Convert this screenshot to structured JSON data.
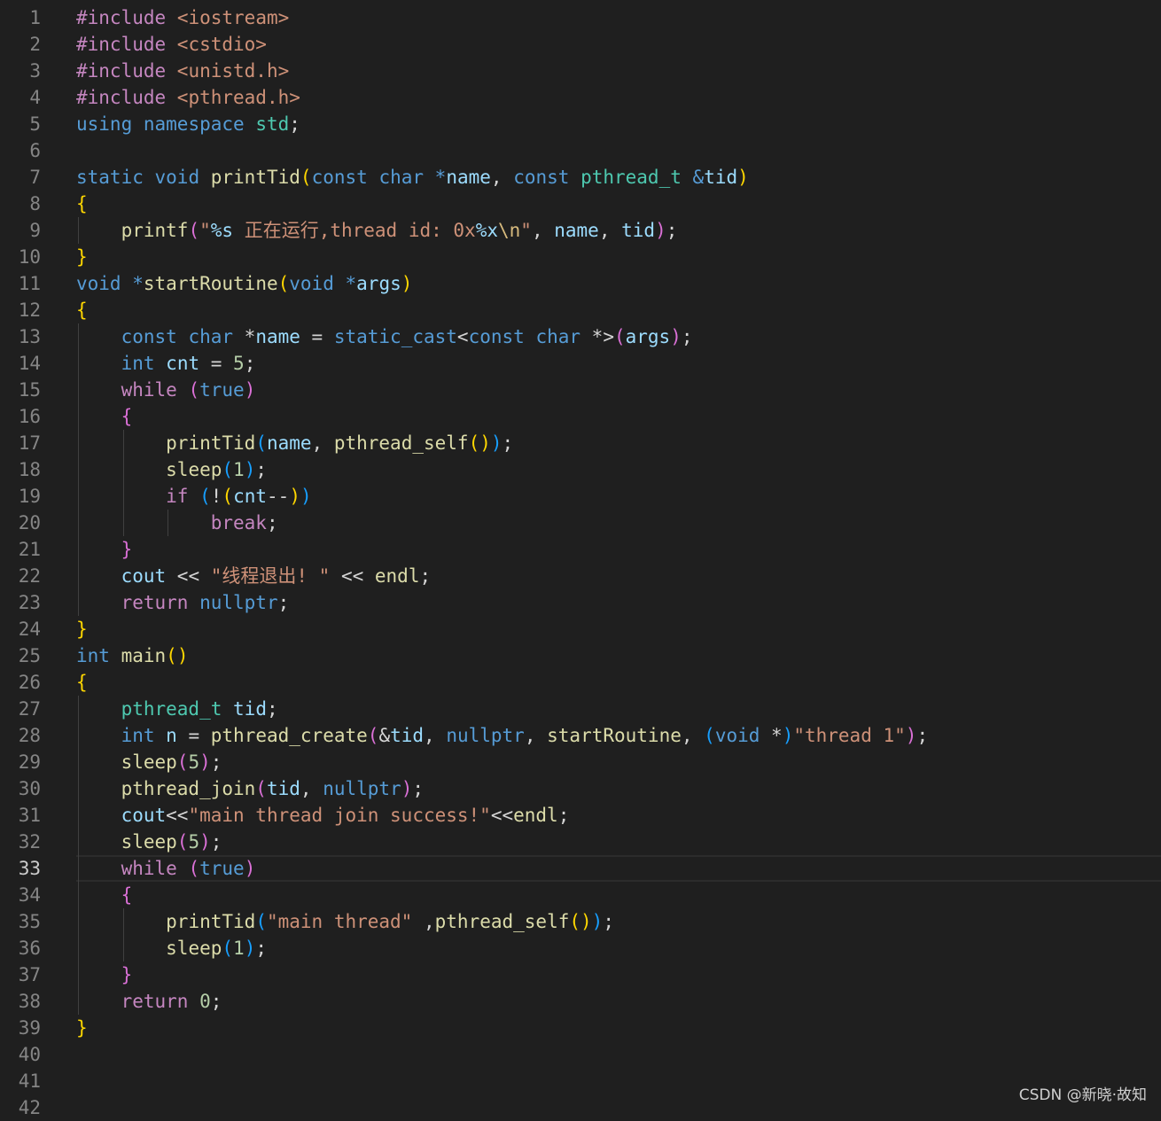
{
  "editor": {
    "language": "cpp",
    "current_line": 33,
    "lines": [
      {
        "n": "1",
        "tokens": [
          [
            "ctl",
            "#include"
          ],
          [
            "",
            "&nbsp;"
          ],
          [
            "str",
            "<iostream>"
          ]
        ]
      },
      {
        "n": "2",
        "tokens": [
          [
            "ctl",
            "#include"
          ],
          [
            "",
            ""
          ],
          [
            "str",
            " <cstdio>"
          ]
        ]
      },
      {
        "n": "3",
        "tokens": [
          [
            "ctl",
            "#include"
          ],
          [
            "str",
            " <unistd.h>"
          ]
        ]
      },
      {
        "n": "4",
        "tokens": [
          [
            "ctl",
            "#include"
          ],
          [
            "str",
            " <pthread.h>"
          ]
        ]
      },
      {
        "n": "5",
        "tokens": [
          [
            "kw",
            "using"
          ],
          [
            "",
            " "
          ],
          [
            "kw",
            "namespace"
          ],
          [
            "",
            " "
          ],
          [
            "typ",
            "std"
          ],
          [
            "",
            ";"
          ]
        ]
      },
      {
        "n": "6",
        "tokens": []
      },
      {
        "n": "7",
        "tokens": [
          [
            "kw",
            "static"
          ],
          [
            "",
            " "
          ],
          [
            "kw",
            "void"
          ],
          [
            "",
            " "
          ],
          [
            "fn",
            "printTid"
          ],
          [
            "b1",
            "("
          ],
          [
            "kw",
            "const"
          ],
          [
            "",
            " "
          ],
          [
            "kw",
            "char"
          ],
          [
            "",
            " "
          ],
          [
            "kw",
            "*"
          ],
          [
            "var",
            "name"
          ],
          [
            "",
            ", "
          ],
          [
            "kw",
            "const"
          ],
          [
            "",
            " "
          ],
          [
            "typ",
            "pthread_t"
          ],
          [
            "",
            " "
          ],
          [
            "kw",
            "&"
          ],
          [
            "var",
            "tid"
          ],
          [
            "b1",
            ")"
          ]
        ]
      },
      {
        "n": "8",
        "tokens": [
          [
            "b1",
            "{"
          ]
        ]
      },
      {
        "n": "9",
        "tokens": [
          [
            "",
            "    "
          ],
          [
            "fn",
            "printf"
          ],
          [
            "b2",
            "("
          ],
          [
            "str",
            "\""
          ],
          [
            "fmt",
            "%s"
          ],
          [
            "str",
            " 正在运行,thread id: 0x"
          ],
          [
            "fmt",
            "%x"
          ],
          [
            "esc",
            "\\n"
          ],
          [
            "str",
            "\""
          ],
          [
            "",
            ", "
          ],
          [
            "var",
            "name"
          ],
          [
            "",
            ", "
          ],
          [
            "var",
            "tid"
          ],
          [
            "b2",
            ")"
          ],
          [
            "",
            ";"
          ]
        ]
      },
      {
        "n": "10",
        "tokens": [
          [
            "b1",
            "}"
          ]
        ]
      },
      {
        "n": "11",
        "tokens": [
          [
            "kw",
            "void"
          ],
          [
            "",
            " "
          ],
          [
            "kw",
            "*"
          ],
          [
            "fn",
            "startRoutine"
          ],
          [
            "b1",
            "("
          ],
          [
            "kw",
            "void"
          ],
          [
            "",
            " "
          ],
          [
            "kw",
            "*"
          ],
          [
            "var",
            "args"
          ],
          [
            "b1",
            ")"
          ]
        ]
      },
      {
        "n": "12",
        "tokens": [
          [
            "b1",
            "{"
          ]
        ]
      },
      {
        "n": "13",
        "tokens": [
          [
            "",
            "    "
          ],
          [
            "kw",
            "const"
          ],
          [
            "",
            " "
          ],
          [
            "kw",
            "char"
          ],
          [
            "",
            " *"
          ],
          [
            "var",
            "name"
          ],
          [
            "",
            " = "
          ],
          [
            "kw",
            "static_cast"
          ],
          [
            "",
            "<"
          ],
          [
            "kw",
            "const"
          ],
          [
            "",
            " "
          ],
          [
            "kw",
            "char"
          ],
          [
            "",
            " *>"
          ],
          [
            "b2",
            "("
          ],
          [
            "var",
            "args"
          ],
          [
            "b2",
            ")"
          ],
          [
            "",
            ";"
          ]
        ]
      },
      {
        "n": "14",
        "tokens": [
          [
            "",
            "    "
          ],
          [
            "kw",
            "int"
          ],
          [
            "",
            " "
          ],
          [
            "var",
            "cnt"
          ],
          [
            "",
            " = "
          ],
          [
            "num",
            "5"
          ],
          [
            "",
            ";"
          ]
        ]
      },
      {
        "n": "15",
        "tokens": [
          [
            "",
            "    "
          ],
          [
            "ctl",
            "while"
          ],
          [
            "",
            " "
          ],
          [
            "b2",
            "("
          ],
          [
            "kw",
            "true"
          ],
          [
            "b2",
            ")"
          ]
        ]
      },
      {
        "n": "16",
        "tokens": [
          [
            "",
            "    "
          ],
          [
            "b2",
            "{"
          ]
        ]
      },
      {
        "n": "17",
        "tokens": [
          [
            "",
            "        "
          ],
          [
            "fn",
            "printTid"
          ],
          [
            "b3",
            "("
          ],
          [
            "var",
            "name"
          ],
          [
            "",
            ", "
          ],
          [
            "fn",
            "pthread_self"
          ],
          [
            "b1",
            "()"
          ],
          [
            "b3",
            ")"
          ],
          [
            "",
            ";"
          ]
        ]
      },
      {
        "n": "18",
        "tokens": [
          [
            "",
            "        "
          ],
          [
            "fn",
            "sleep"
          ],
          [
            "b3",
            "("
          ],
          [
            "num",
            "1"
          ],
          [
            "b3",
            ")"
          ],
          [
            "",
            ";"
          ]
        ]
      },
      {
        "n": "19",
        "tokens": [
          [
            "",
            "        "
          ],
          [
            "ctl",
            "if"
          ],
          [
            "",
            " "
          ],
          [
            "b3",
            "("
          ],
          [
            "",
            "!"
          ],
          [
            "b1",
            "("
          ],
          [
            "var",
            "cnt"
          ],
          [
            "",
            "--"
          ],
          [
            "b1",
            ")"
          ],
          [
            "b3",
            ")"
          ]
        ]
      },
      {
        "n": "20",
        "tokens": [
          [
            "",
            "            "
          ],
          [
            "ctl",
            "break"
          ],
          [
            "",
            ";"
          ]
        ]
      },
      {
        "n": "21",
        "tokens": [
          [
            "",
            "    "
          ],
          [
            "b2",
            "}"
          ]
        ]
      },
      {
        "n": "22",
        "tokens": [
          [
            "",
            "    "
          ],
          [
            "var",
            "cout"
          ],
          [
            "",
            " << "
          ],
          [
            "str",
            "\"线程退出! \""
          ],
          [
            "",
            " << "
          ],
          [
            "fn",
            "endl"
          ],
          [
            "",
            ";"
          ]
        ]
      },
      {
        "n": "23",
        "tokens": [
          [
            "",
            "    "
          ],
          [
            "ctl",
            "return"
          ],
          [
            "",
            " "
          ],
          [
            "kw",
            "nullptr"
          ],
          [
            "",
            ";"
          ]
        ]
      },
      {
        "n": "24",
        "tokens": [
          [
            "b1",
            "}"
          ]
        ]
      },
      {
        "n": "25",
        "tokens": [
          [
            "kw",
            "int"
          ],
          [
            "",
            " "
          ],
          [
            "fn",
            "main"
          ],
          [
            "b1",
            "()"
          ]
        ]
      },
      {
        "n": "26",
        "tokens": [
          [
            "b1",
            "{"
          ]
        ]
      },
      {
        "n": "27",
        "tokens": [
          [
            "",
            "    "
          ],
          [
            "typ",
            "pthread_t"
          ],
          [
            "",
            " "
          ],
          [
            "var",
            "tid"
          ],
          [
            "",
            ";"
          ]
        ]
      },
      {
        "n": "28",
        "tokens": [
          [
            "",
            "    "
          ],
          [
            "kw",
            "int"
          ],
          [
            "",
            " "
          ],
          [
            "var",
            "n"
          ],
          [
            "",
            " = "
          ],
          [
            "fn",
            "pthread_create"
          ],
          [
            "b2",
            "("
          ],
          [
            "",
            "&"
          ],
          [
            "var",
            "tid"
          ],
          [
            "",
            ", "
          ],
          [
            "kw",
            "nullptr"
          ],
          [
            "",
            ", "
          ],
          [
            "fn",
            "startRoutine"
          ],
          [
            "",
            ", "
          ],
          [
            "b3",
            "("
          ],
          [
            "kw",
            "void"
          ],
          [
            "",
            " *"
          ],
          [
            "b3",
            ")"
          ],
          [
            "str",
            "\"thread 1\""
          ],
          [
            "b2",
            ")"
          ],
          [
            "",
            ";"
          ]
        ]
      },
      {
        "n": "29",
        "tokens": [
          [
            "",
            "    "
          ],
          [
            "fn",
            "sleep"
          ],
          [
            "b2",
            "("
          ],
          [
            "num",
            "5"
          ],
          [
            "b2",
            ")"
          ],
          [
            "",
            ";"
          ]
        ]
      },
      {
        "n": "30",
        "tokens": [
          [
            "",
            "    "
          ],
          [
            "fn",
            "pthread_join"
          ],
          [
            "b2",
            "("
          ],
          [
            "var",
            "tid"
          ],
          [
            "",
            ", "
          ],
          [
            "kw",
            "nullptr"
          ],
          [
            "b2",
            ")"
          ],
          [
            "",
            ";"
          ]
        ]
      },
      {
        "n": "31",
        "tokens": [
          [
            "",
            "    "
          ],
          [
            "var",
            "cout"
          ],
          [
            "",
            "<<"
          ],
          [
            "str",
            "\"main thread join success!\""
          ],
          [
            "",
            "<<"
          ],
          [
            "fn",
            "endl"
          ],
          [
            "",
            ";"
          ]
        ]
      },
      {
        "n": "32",
        "tokens": [
          [
            "",
            "    "
          ],
          [
            "fn",
            "sleep"
          ],
          [
            "b2",
            "("
          ],
          [
            "num",
            "5"
          ],
          [
            "b2",
            ")"
          ],
          [
            "",
            ";"
          ]
        ]
      },
      {
        "n": "33",
        "tokens": [
          [
            "",
            "    "
          ],
          [
            "ctl",
            "while"
          ],
          [
            "",
            " "
          ],
          [
            "b2",
            "("
          ],
          [
            "kw",
            "true"
          ],
          [
            "b2",
            ")"
          ]
        ]
      },
      {
        "n": "34",
        "tokens": [
          [
            "",
            "    "
          ],
          [
            "b2",
            "{"
          ]
        ]
      },
      {
        "n": "35",
        "tokens": [
          [
            "",
            "        "
          ],
          [
            "fn",
            "printTid"
          ],
          [
            "b3",
            "("
          ],
          [
            "str",
            "\"main thread\""
          ],
          [
            "",
            " ,"
          ],
          [
            "fn",
            "pthread_self"
          ],
          [
            "b1",
            "()"
          ],
          [
            "b3",
            ")"
          ],
          [
            "",
            ";"
          ]
        ]
      },
      {
        "n": "36",
        "tokens": [
          [
            "",
            "        "
          ],
          [
            "fn",
            "sleep"
          ],
          [
            "b3",
            "("
          ],
          [
            "num",
            "1"
          ],
          [
            "b3",
            ")"
          ],
          [
            "",
            ";"
          ]
        ]
      },
      {
        "n": "37",
        "tokens": [
          [
            "",
            "    "
          ],
          [
            "b2",
            "}"
          ]
        ]
      },
      {
        "n": "38",
        "tokens": [
          [
            "",
            "    "
          ],
          [
            "ctl",
            "return"
          ],
          [
            "",
            " "
          ],
          [
            "num",
            "0"
          ],
          [
            "",
            ";"
          ]
        ]
      },
      {
        "n": "39",
        "tokens": [
          [
            "b1",
            "}"
          ]
        ]
      },
      {
        "n": "40",
        "tokens": []
      },
      {
        "n": "41",
        "tokens": []
      },
      {
        "n": "42",
        "tokens": []
      }
    ]
  },
  "watermark": "CSDN @新晓·故知"
}
